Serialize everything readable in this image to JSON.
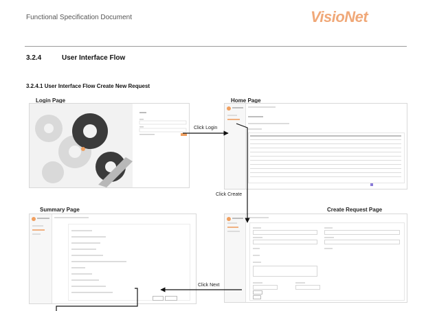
{
  "header": {
    "doc_title": "Functional Specification Document",
    "logo_text": "VisioNet"
  },
  "section": {
    "number": "3.2.4",
    "title": "User Interface Flow"
  },
  "subsection": {
    "title": "3.2.4.1 User Interface Flow Create New Request"
  },
  "pages": {
    "login": "Login Page",
    "home": "Home Page",
    "summary": "Summary Page",
    "create": "Create Request Page"
  },
  "arrows": {
    "click_login": "Click Login",
    "click_create": "Click Create",
    "click_next": "Click Next"
  }
}
